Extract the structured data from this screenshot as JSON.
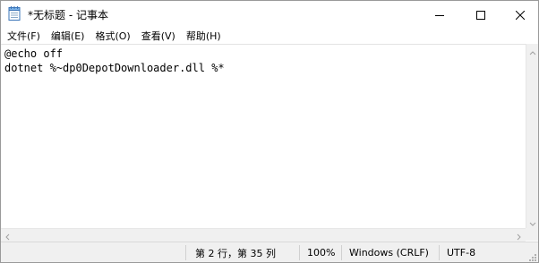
{
  "window": {
    "title": "*无标题 - 记事本"
  },
  "icons": {
    "app": "notepad-icon",
    "minimize": "minimize-icon",
    "maximize": "maximize-icon",
    "close": "close-icon"
  },
  "menu": {
    "items": [
      {
        "label": "文件(F)"
      },
      {
        "label": "编辑(E)"
      },
      {
        "label": "格式(O)"
      },
      {
        "label": "查看(V)"
      },
      {
        "label": "帮助(H)"
      }
    ]
  },
  "editor": {
    "lines": [
      "@echo off",
      "dotnet %~dp0DepotDownloader.dll %*"
    ]
  },
  "status": {
    "position": "第 2 行，第 35 列",
    "zoom": "100%",
    "line_ending": "Windows (CRLF)",
    "encoding": "UTF-8"
  },
  "colors": {
    "status_bar_bg": "#f0f0f0",
    "window_bg": "#ffffff",
    "text": "#000000"
  }
}
